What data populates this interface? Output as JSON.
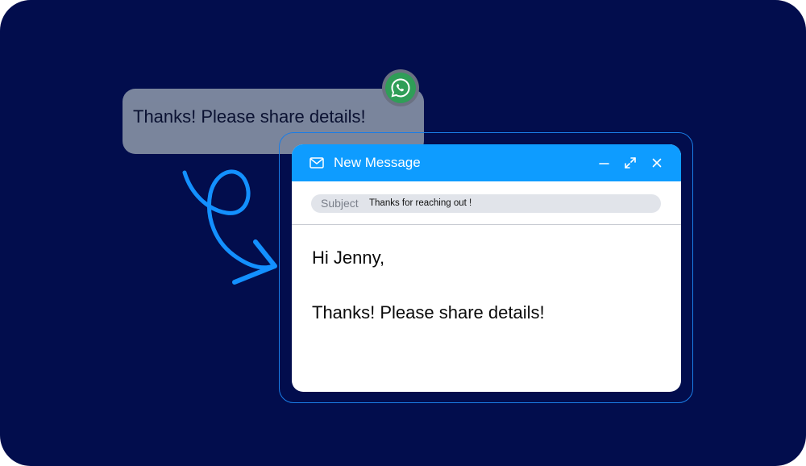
{
  "chat": {
    "message": "Thanks! Please share details!",
    "app_icon": "whatsapp-icon"
  },
  "email": {
    "title": "New Message",
    "title_icon": "mail-icon",
    "controls": [
      "minimize-icon",
      "expand-icon",
      "close-icon"
    ],
    "subject_label": "Subject",
    "subject_value": "Thanks for reaching out !",
    "body_greeting": "Hi Jenny,",
    "body_message": "Thanks! Please share details!"
  },
  "colors": {
    "background": "#020d4d",
    "accent": "#0e9cff",
    "chat_bubble": "#7f8aa0",
    "whatsapp_green": "#2f9e57"
  }
}
